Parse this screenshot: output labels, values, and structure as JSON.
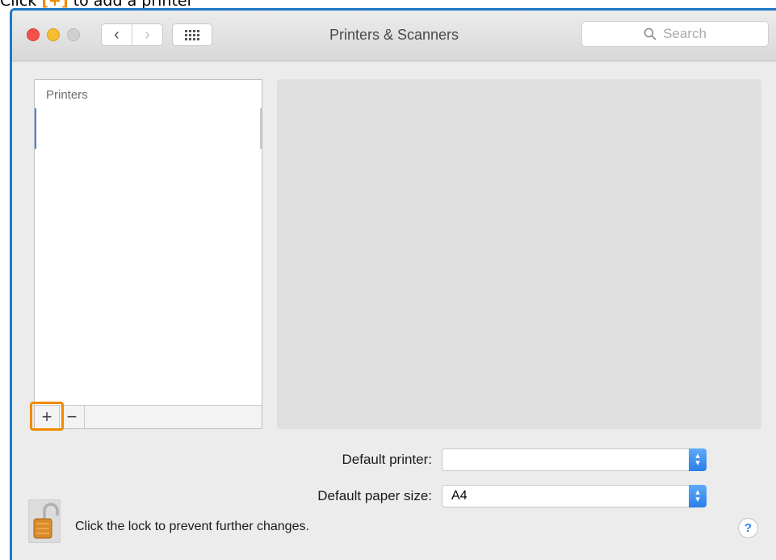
{
  "instruction": {
    "prefix": "Click",
    "symbol": "+",
    "suffix": "to add a printer"
  },
  "window": {
    "title": "Printers & Scanners",
    "nav_back": "‹",
    "nav_forward": "›",
    "search_placeholder": "Search",
    "search_icon": "magnifier-icon"
  },
  "printers_list": {
    "header": "Printers",
    "add_label": "+",
    "remove_label": "−"
  },
  "form": {
    "default_printer_label": "Default printer:",
    "default_printer_value": "",
    "paper_size_label": "Default paper size:",
    "paper_size_value": "A4"
  },
  "footer": {
    "lock_text": "Click the lock to prevent further changes.",
    "help_label": "?"
  },
  "colors": {
    "highlight": "#f08a00",
    "window_border": "#1f77c9",
    "select_accent": "#2b7fe8"
  }
}
